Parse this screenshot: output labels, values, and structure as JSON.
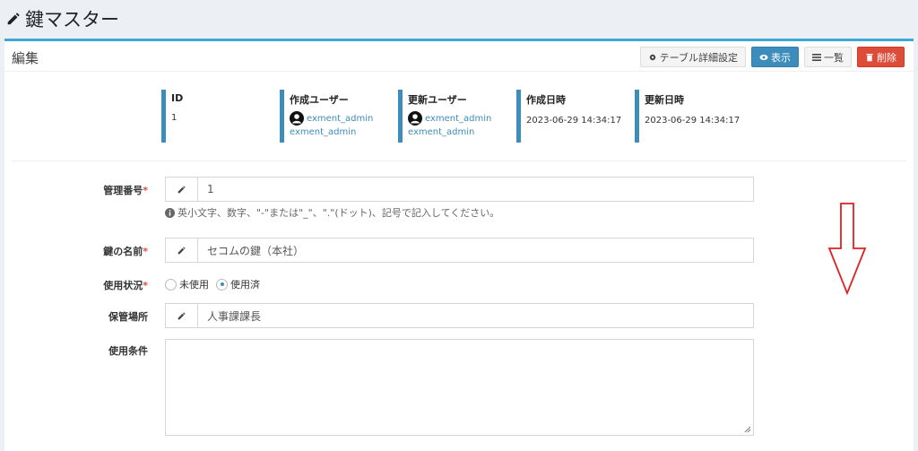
{
  "header": {
    "title": "鍵マスター"
  },
  "box": {
    "title": "編集",
    "buttons": {
      "table_settings": "テーブル詳細設定",
      "show": "表示",
      "list": "一覧",
      "delete": "削除"
    }
  },
  "info": [
    {
      "label": "ID",
      "value": "1"
    },
    {
      "label": "作成ユーザー",
      "user": "exment_admin",
      "user2": "exment_admin"
    },
    {
      "label": "更新ユーザー",
      "user": "exment_admin",
      "user2": "exment_admin"
    },
    {
      "label": "作成日時",
      "value": "2023-06-29 14:34:17"
    },
    {
      "label": "更新日時",
      "value": "2023-06-29 14:34:17"
    }
  ],
  "form": {
    "kanri_label": "管理番号",
    "kanri_value": "1",
    "kanri_help": "英小文字、数字、\"-\"または\"_\"、\".\"(ドット)、記号で記入してください。",
    "name_label": "鍵の名前",
    "name_value": "セコムの鍵（本社）",
    "status_label": "使用状況",
    "status_options": [
      "未使用",
      "使用済"
    ],
    "status_selected": "使用済",
    "place_label": "保管場所",
    "place_value": "人事課課長",
    "cond_label": "使用条件",
    "required_mark": "*"
  },
  "colors": {
    "accent": "#3c8dbc",
    "danger": "#dd4b39",
    "arrow": "#e02020"
  }
}
